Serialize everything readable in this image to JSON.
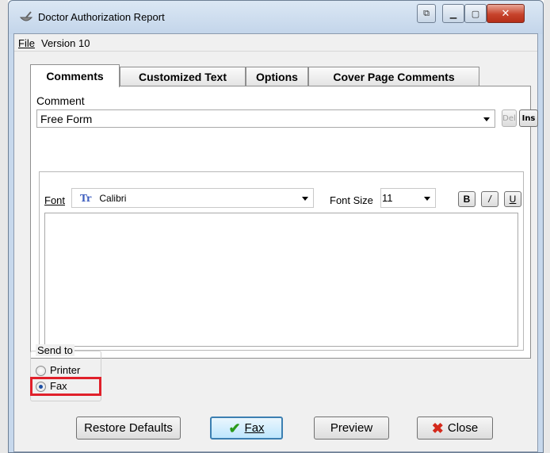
{
  "window": {
    "title": "Doctor Authorization Report",
    "buttons": [
      "restore-icon",
      "minimize-icon",
      "maximize-icon",
      "close-icon"
    ]
  },
  "menu": {
    "file": "File",
    "version": "Version 10"
  },
  "tabs": [
    "Comments",
    "Customized Text",
    "Options",
    "Cover Page Comments"
  ],
  "comment": {
    "label": "Comment",
    "value": "Free Form",
    "del_label": "Del",
    "ins_label": "Ins"
  },
  "editor": {
    "font_label": "Font",
    "font_value": "Calibri",
    "font_size_label": "Font Size",
    "font_size_value": "11",
    "bold_label": "B",
    "italic_label": "/",
    "underline_label": "U"
  },
  "send_to": {
    "label": "Send to",
    "options": [
      "Printer",
      "Fax"
    ],
    "selected": "Fax"
  },
  "buttons": {
    "restore_defaults": "Restore Defaults",
    "fax": "Fax",
    "preview": "Preview",
    "close": "Close"
  },
  "colors": {
    "highlight": "#e0202a",
    "check": "#2a9a1a",
    "close_x": "#d42a1c"
  }
}
